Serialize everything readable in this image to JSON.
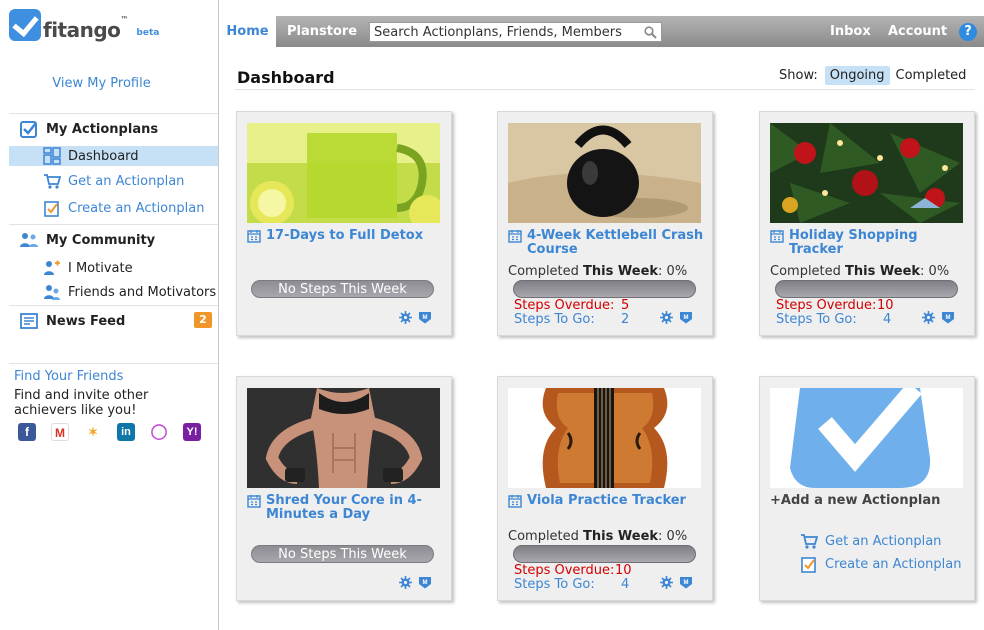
{
  "brand": {
    "name": "fitango",
    "tm": "™",
    "beta": "beta"
  },
  "sidebar": {
    "view_profile": "View My Profile",
    "actionplans_title": "My Actionplans",
    "dashboard": "Dashboard",
    "get_actionplan": "Get an Actionplan",
    "create_actionplan": "Create an Actionplan",
    "community_title": "My Community",
    "i_motivate": "I Motivate",
    "friends": "Friends and Motivators",
    "news_feed": "News Feed",
    "news_badge": "2",
    "find_friends": "Find Your Friends",
    "find_desc": "Find and invite other achievers like you!",
    "social": [
      {
        "name": "facebook",
        "glyph": "f",
        "color": "#3b5998"
      },
      {
        "name": "gmail",
        "glyph": "M",
        "color": "#d93025"
      },
      {
        "name": "msn",
        "glyph": "✶",
        "color": "#f5a623"
      },
      {
        "name": "linkedin",
        "glyph": "in",
        "color": "#0e76a8"
      },
      {
        "name": "aol",
        "glyph": "◯",
        "color": "#c64fd6"
      },
      {
        "name": "yahoo",
        "glyph": "Y!",
        "color": "#7b1fa2"
      }
    ]
  },
  "nav": {
    "home": "Home",
    "planstore": "Planstore",
    "search_placeholder": "Search Actionplans, Friends, Members",
    "inbox": "Inbox",
    "account": "Account",
    "help": "?"
  },
  "main": {
    "title": "Dashboard",
    "show_label": "Show:",
    "ongoing": "Ongoing",
    "completed": "Completed"
  },
  "cards": [
    {
      "title": "17-Days to Full Detox",
      "no_steps": "No Steps This Week",
      "image": "lemonade"
    },
    {
      "title": "4-Week Kettlebell Crash Course",
      "completed_prefix": "Completed ",
      "this_week": "This Week",
      "completed_suffix": ": 0%",
      "overdue_label": "Steps Overdue:",
      "overdue": "5",
      "togo_label": "Steps To Go:",
      "togo": "2",
      "progress": 0,
      "image": "kettlebell"
    },
    {
      "title": "Holiday Shopping Tracker",
      "completed_prefix": "Completed ",
      "this_week": "This Week",
      "completed_suffix": ": 0%",
      "overdue_label": "Steps Overdue:",
      "overdue": "10",
      "togo_label": "Steps To Go:",
      "togo": "4",
      "progress": 0,
      "image": "christmas-tree"
    },
    {
      "title": "Shred Your Core in 4-Minutes a Day",
      "no_steps": "No Steps This Week",
      "image": "fitness-woman"
    },
    {
      "title": "Viola Practice Tracker",
      "completed_prefix": "Completed ",
      "this_week": "This Week",
      "completed_suffix": ": 0%",
      "overdue_label": "Steps Overdue:",
      "overdue": "10",
      "togo_label": "Steps To Go:",
      "togo": "4",
      "progress": 0,
      "image": "viola"
    }
  ],
  "add_card": {
    "title": "+Add a new Actionplan",
    "get": "Get an Actionplan",
    "create": "Create an Actionplan"
  },
  "colors": {
    "accent": "#3d86d3",
    "overdue": "#d20000",
    "badge": "#f0962b"
  }
}
